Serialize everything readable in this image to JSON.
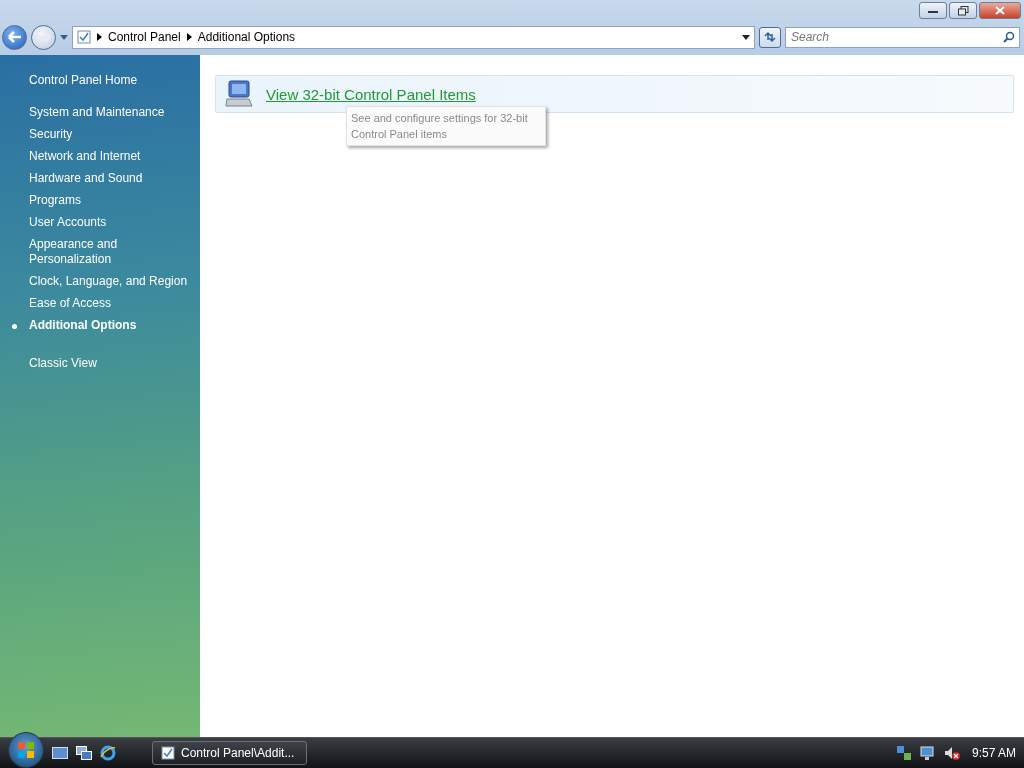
{
  "address_bar": {
    "breadcrumbs": [
      "Control Panel",
      "Additional Options"
    ]
  },
  "search": {
    "placeholder": "Search"
  },
  "sidebar": {
    "home": "Control Panel Home",
    "items": [
      {
        "label": "System and Maintenance",
        "selected": false
      },
      {
        "label": "Security",
        "selected": false
      },
      {
        "label": "Network and Internet",
        "selected": false
      },
      {
        "label": "Hardware and Sound",
        "selected": false
      },
      {
        "label": "Programs",
        "selected": false
      },
      {
        "label": "User Accounts",
        "selected": false
      },
      {
        "label": "Appearance and Personalization",
        "selected": false
      },
      {
        "label": "Clock, Language, and Region",
        "selected": false
      },
      {
        "label": "Ease of Access",
        "selected": false
      },
      {
        "label": "Additional Options",
        "selected": true
      }
    ],
    "classic_view": "Classic View"
  },
  "content": {
    "link": "View 32-bit Control Panel Items",
    "tooltip": "See and configure settings for 32-bit Control Panel items"
  },
  "taskbar": {
    "window_button": "Control Panel\\Addit...",
    "clock": "9:57 AM"
  }
}
